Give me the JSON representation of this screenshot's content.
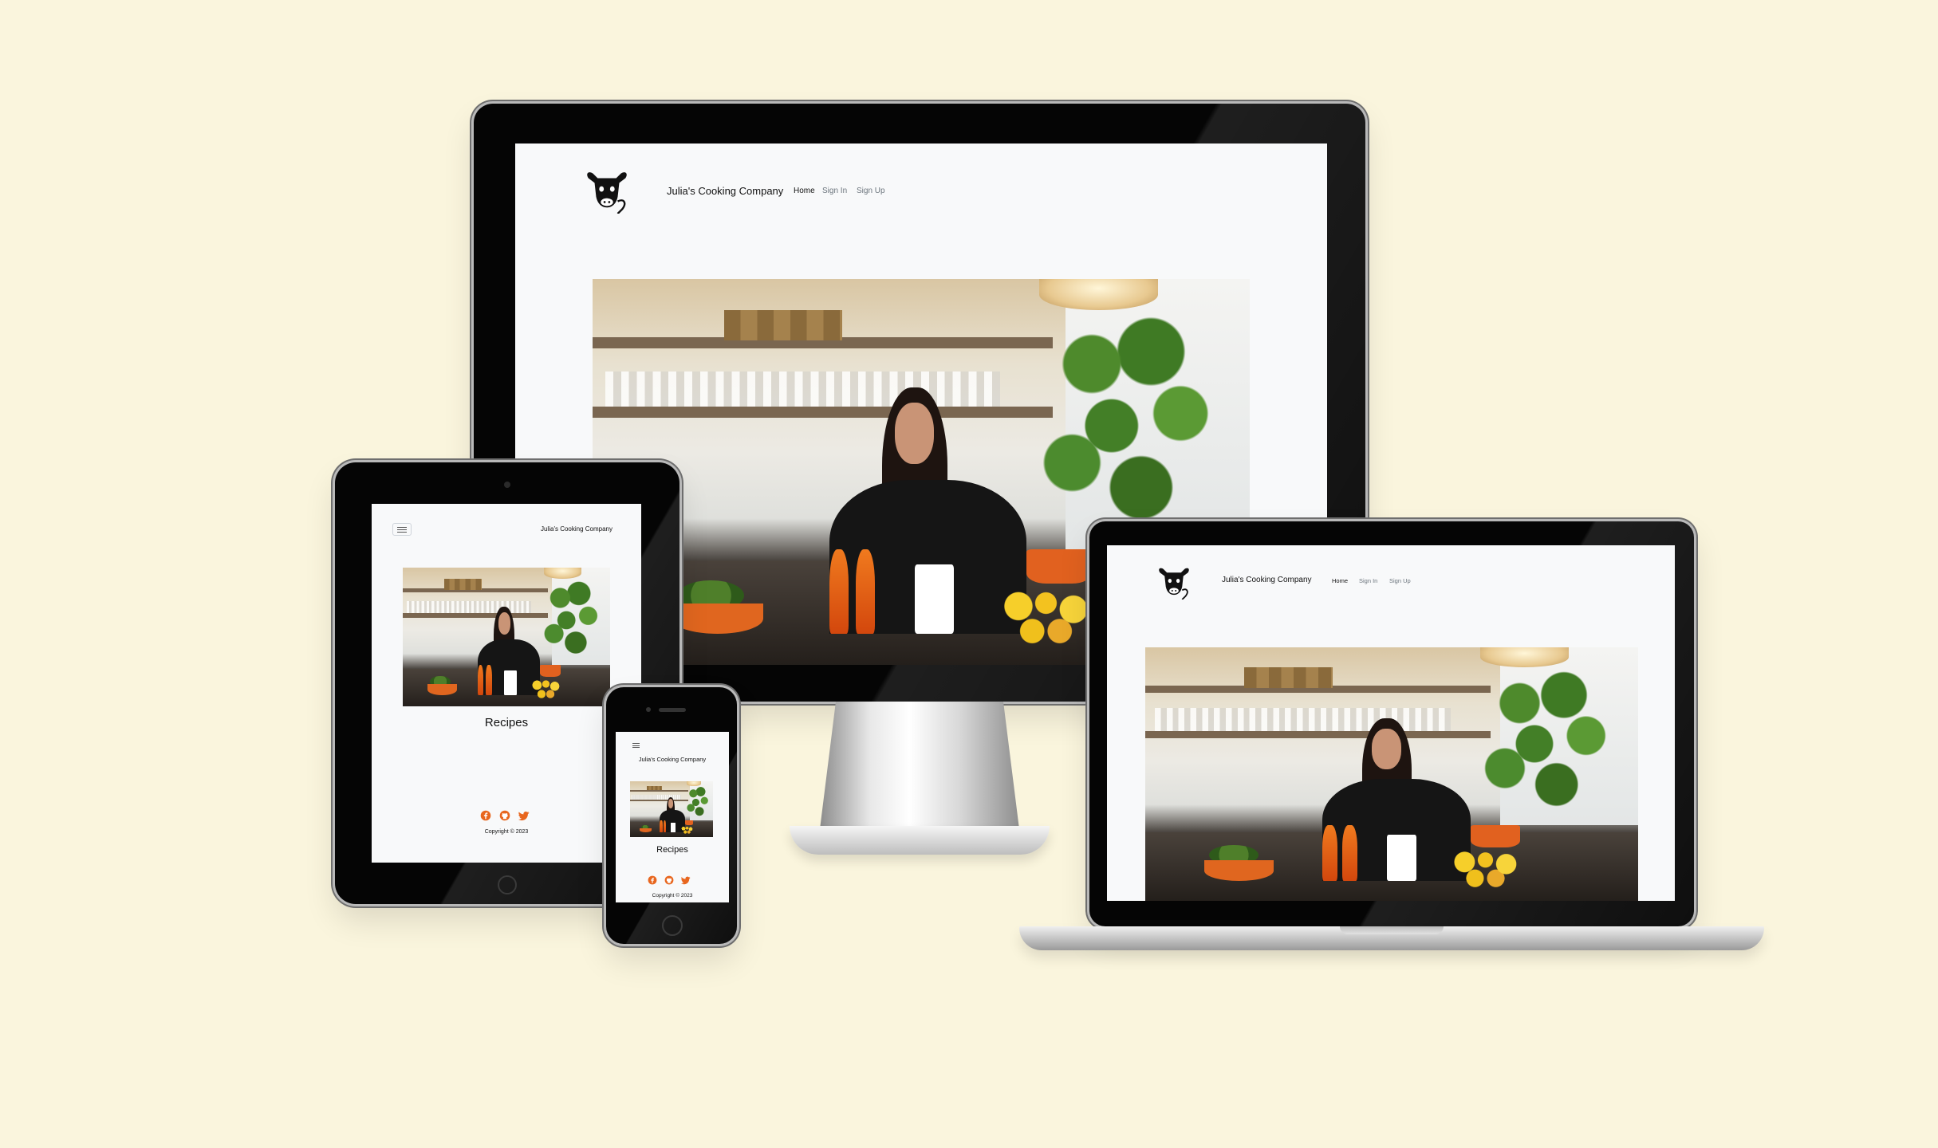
{
  "site": {
    "brand": "Julia's Cooking Company",
    "nav": [
      "Home",
      "Sign In",
      "Sign Up"
    ],
    "page_heading": "Recipes",
    "copyright": "Copyright © 2023",
    "social_icons": [
      "facebook-icon",
      "github-icon",
      "twitter-icon"
    ],
    "accent_color": "#e8661e",
    "logo_icon": "cow-head-icon"
  },
  "mockup": {
    "background_color": "#faf5dd",
    "devices": [
      "monitor",
      "laptop",
      "tablet",
      "phone"
    ]
  }
}
